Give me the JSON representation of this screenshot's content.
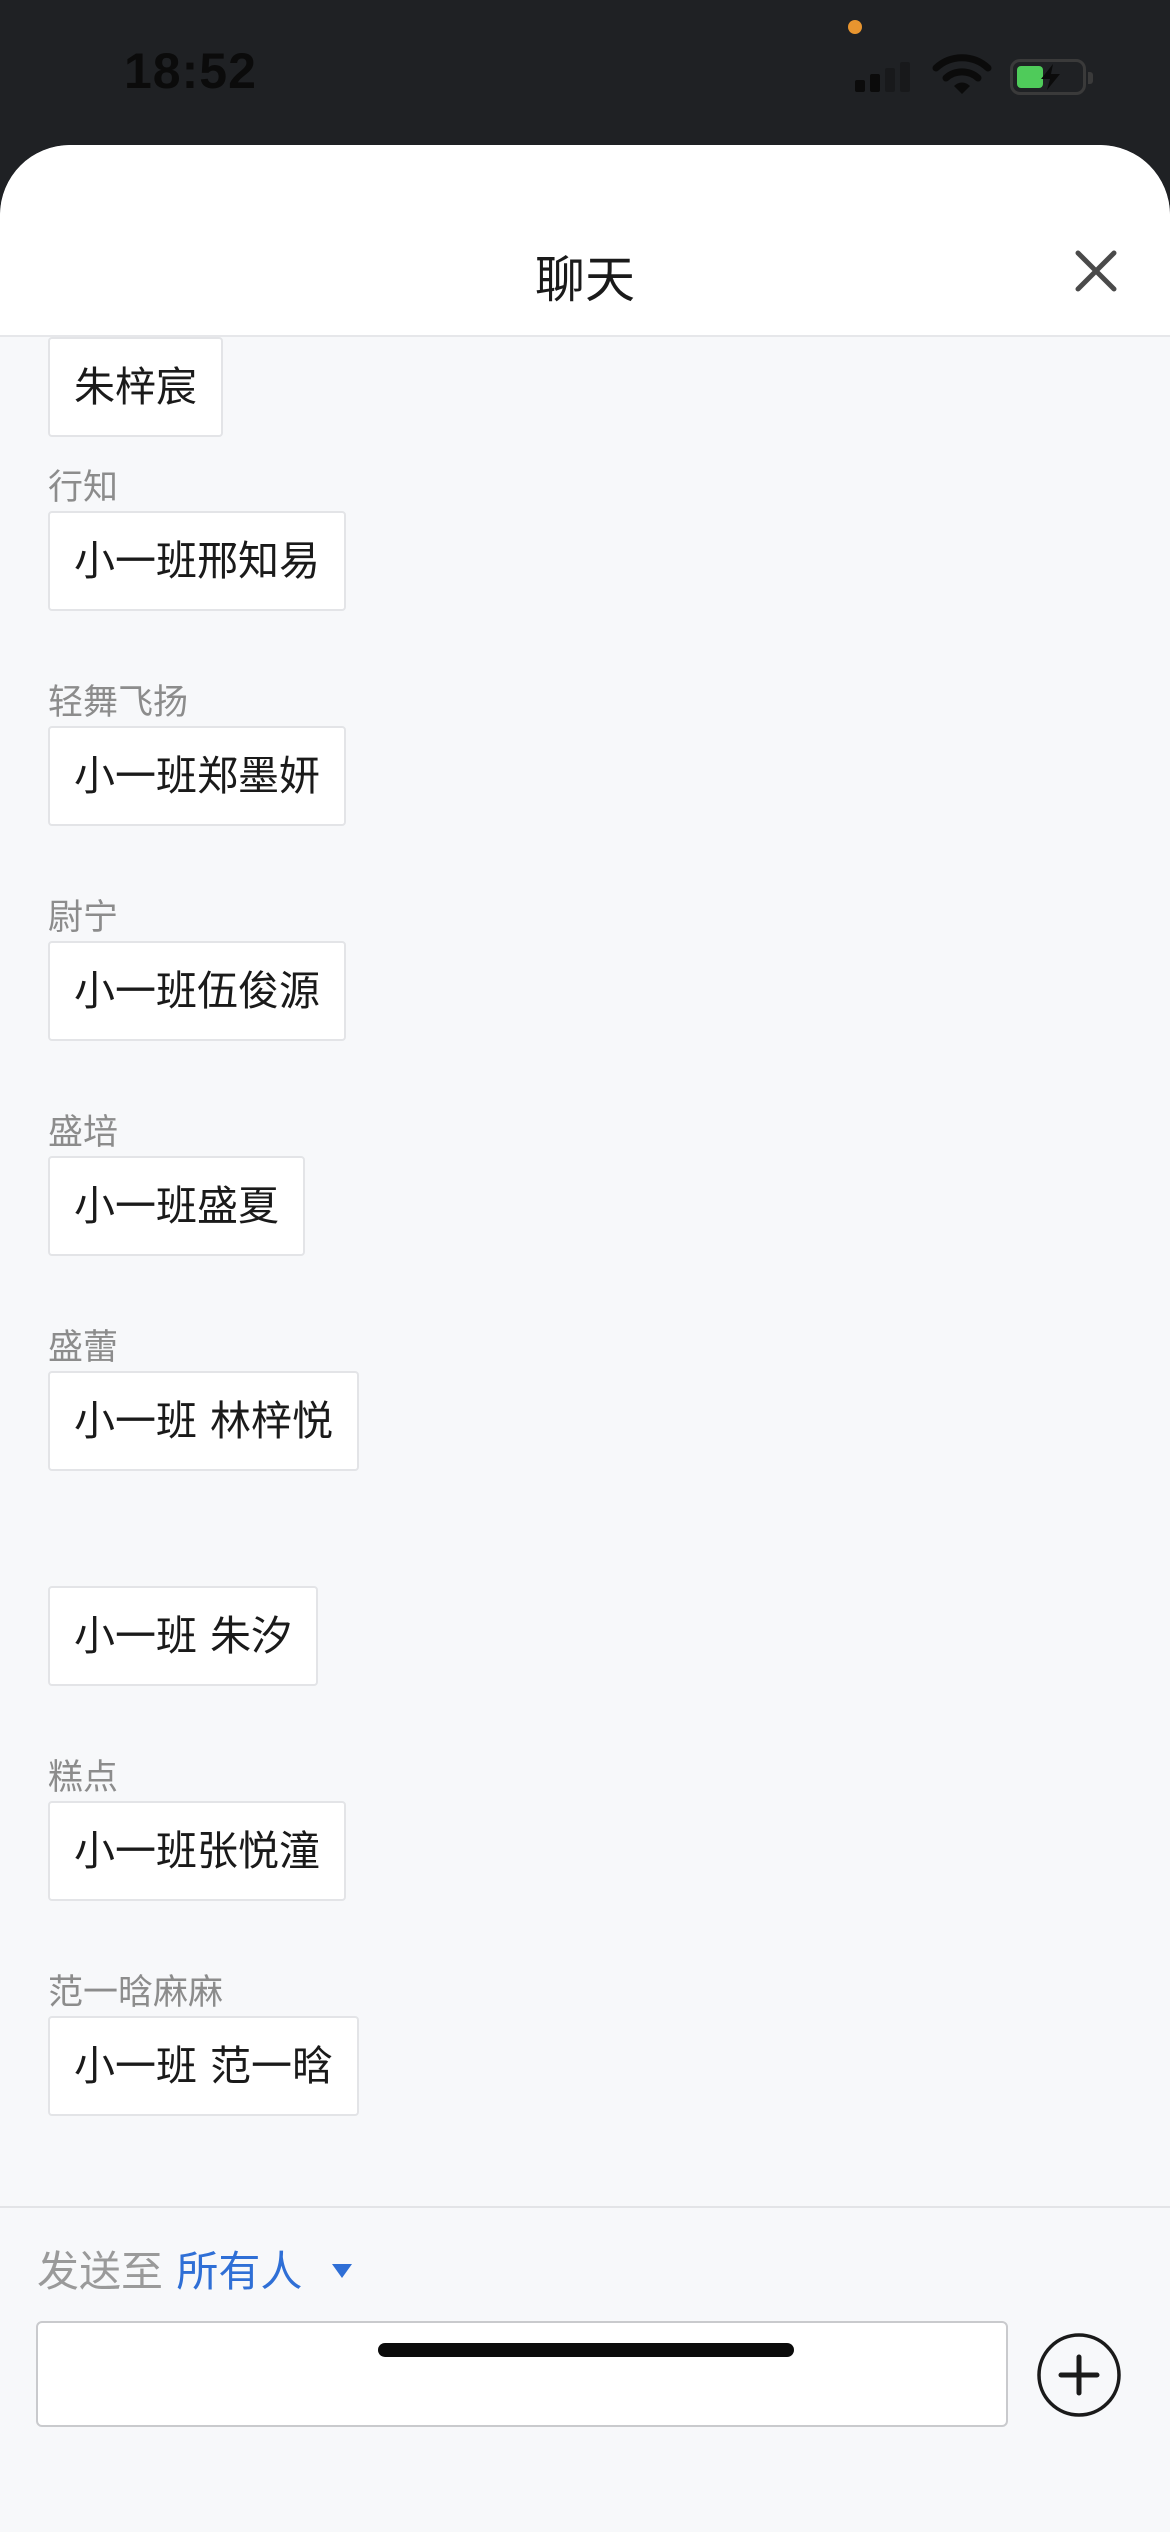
{
  "status_bar": {
    "time": "18:52"
  },
  "header": {
    "title": "聊天"
  },
  "messages": [
    {
      "sender": "",
      "text": "朱梓宸"
    },
    {
      "sender": "行知",
      "text": "小一班邢知易"
    },
    {
      "sender": "轻舞飞扬",
      "text": "小一班郑墨妍"
    },
    {
      "sender": "尉宁",
      "text": "小一班伍俊源"
    },
    {
      "sender": "盛培",
      "text": "小一班盛夏"
    },
    {
      "sender": "盛蕾",
      "text": "小一班 林梓悦"
    },
    {
      "sender": "",
      "text": "小一班 朱汐"
    },
    {
      "sender": "糕点",
      "text": "小一班张悦潼"
    },
    {
      "sender": "范一晗麻麻",
      "text": "小一班 范一晗"
    }
  ],
  "footer": {
    "send_to_label": "发送至",
    "send_to_target": "所有人",
    "input_value": "",
    "input_placeholder": ""
  },
  "colors": {
    "accent": "#2f6fd6",
    "background": "#f7f8fa",
    "battery": "#4fcb5a"
  }
}
